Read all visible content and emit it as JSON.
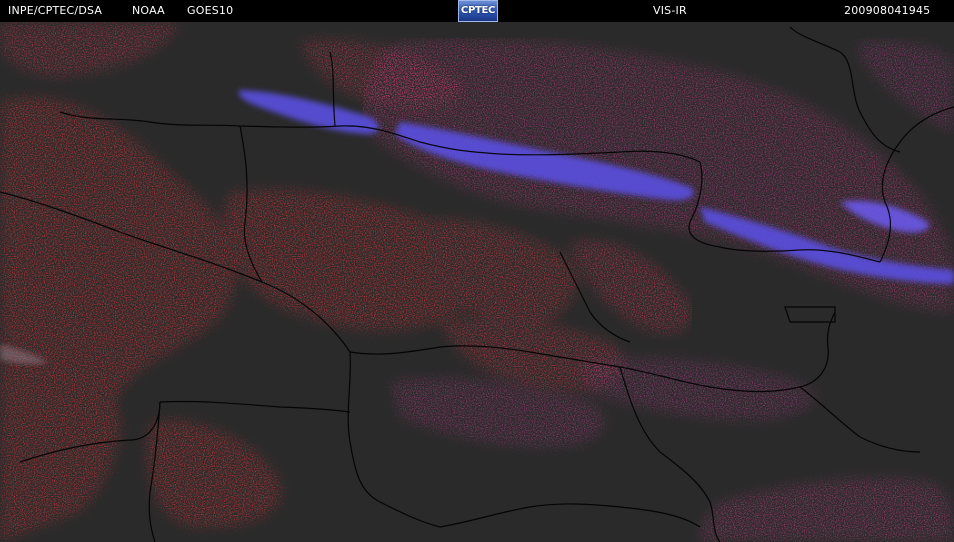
{
  "header": {
    "source": "INPE/CPTEC/DSA",
    "agency": "NOAA",
    "satellite": "GOES10",
    "logo_text": "CPTEC",
    "channel": "VIS-IR",
    "timestamp": "200908041945"
  },
  "colors": {
    "ground": "#2a2a2a",
    "low_cloud": "#d8383c",
    "mid_cloud": "#b03a78",
    "high_cloud": "#5a50e0",
    "boundaries": "#000000",
    "logo": "#2f54b0"
  }
}
